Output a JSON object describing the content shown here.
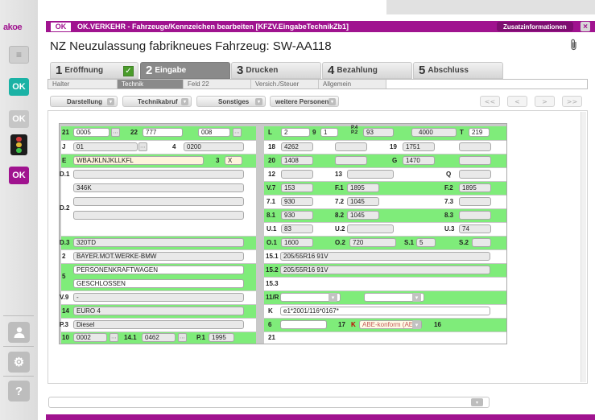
{
  "app": {
    "logo": "akoe",
    "window_title": "OK.VERKEHR - Fahrzeuge/Kennzeichen bearbeiten [KFZV.EingabeTechnikZb1]",
    "ok_logo": "OK",
    "zusatz_label": "Zusatzinformationen",
    "close_glyph": "×"
  },
  "rail": {
    "doc_glyph": "≡",
    "ok1": "OK",
    "ok2": "OK",
    "ok3": "OK",
    "person_glyph": "👤",
    "gear_glyph": "⚙",
    "help_glyph": "?"
  },
  "page_title": "NZ Neuzulassung fabrikneues Fahrzeug: SW-AA118",
  "clip_glyph": "🖇",
  "steps": [
    {
      "num": "1",
      "label": "Eröffnung"
    },
    {
      "num": "2",
      "label": "Eingabe"
    },
    {
      "num": "3",
      "label": "Drucken"
    },
    {
      "num": "4",
      "label": "Bezahlung"
    },
    {
      "num": "5",
      "label": "Abschluss"
    }
  ],
  "step_check": "✓",
  "subtabs": [
    "Halter",
    "Technik",
    "Feld 22",
    "Versich./Steuer",
    "Allgemein"
  ],
  "toolbar": {
    "darstellung": "Darstellung",
    "technikabruf": "Technikabruf",
    "sonstiges": "Sonstiges",
    "weitere": "weitere Personen",
    "dd": "▾",
    "first": "<<",
    "prev": "<",
    "next": ">",
    "last": ">>"
  },
  "form": {
    "l21": "21",
    "f21": "0005",
    "l22": "22",
    "f22a": "777",
    "f22b": "008",
    "lJ": "J",
    "fJ": "01",
    "l4": "4",
    "f4": "0200",
    "lE": "E",
    "fE": "WBAJKLNJKLLKFL",
    "l3": "3",
    "f3": "X",
    "lD1": "D.1",
    "fD1b": "346K",
    "lD2": "D.2",
    "lD3": "D.3",
    "fD3": "320TD",
    "l2": "2",
    "f2": "BAYER.MOT.WERKE-BMW",
    "l5": "5",
    "f5a": "PERSONENKRAFTWAGEN",
    "f5b": "GESCHLOSSEN",
    "lV9": "V.9",
    "fV9": "-",
    "l14": "14",
    "f14": "EURO 4",
    "lP3": "P.3",
    "fP3": "Diesel",
    "l10": "10",
    "f10": "0002",
    "l141": "14.1",
    "f141": "0462",
    "lP1": "P.1",
    "fP1": "1995",
    "lL": "L",
    "fL": "2",
    "l9": "9",
    "f9": "1",
    "lP4": "P.4\nP.2",
    "fP4a": "93",
    "fP4b": "4000",
    "lT": "T",
    "fT": "219",
    "l18": "18",
    "f18": "4262",
    "l19": "19",
    "f19": "1751",
    "l20": "20",
    "f20": "1408",
    "lG": "G",
    "fG": "1470",
    "l12": "12",
    "l13": "13",
    "lQ": "Q",
    "lV7": "V.7",
    "fV7": "153",
    "lF1": "F.1",
    "fF1": "1895",
    "lF2": "F.2",
    "fF2": "1895",
    "l71": "7.1",
    "f71": "930",
    "l72": "7.2",
    "f72": "1045",
    "l73": "7.3",
    "l81": "8.1",
    "f81": "930",
    "l82": "8.2",
    "f82": "1045",
    "l83": "8.3",
    "lU1": "U.1",
    "fU1": "83",
    "lU2": "U.2",
    "lU3": "U.3",
    "fU3": "74",
    "lO1": "O.1",
    "fO1": "1600",
    "lO2": "O.2",
    "fO2": "720",
    "lS1": "S.1",
    "fS1": "5",
    "lS2": "S.2",
    "l151": "15.1",
    "f151": "205/55R16 91V",
    "l152": "15.2",
    "f152": "205/55R16 91V",
    "l153": "15.3",
    "l11R": "11/R",
    "lK": "K",
    "fK": "e1*2001/116*0167*",
    "l6": "6",
    "l17": "17",
    "lK2": "K",
    "fK2": "ABE-konform (AE",
    "l16": "16",
    "l21b": "21",
    "btn": "⋯"
  }
}
